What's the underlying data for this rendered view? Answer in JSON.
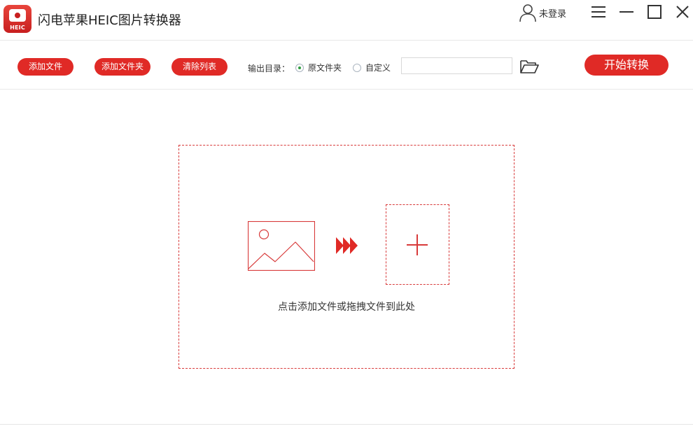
{
  "app": {
    "logo_text": "HEIC",
    "title": "闪电苹果HEIC图片转换器"
  },
  "user": {
    "login_label": "未登录"
  },
  "toolbar": {
    "add_file_label": "添加文件",
    "add_folder_label": "添加文件夹",
    "clear_list_label": "清除列表",
    "output_dir_label": "输出目录：",
    "option_original_label": "原文件夹",
    "option_custom_label": "自定义",
    "selected_option": "原文件夹",
    "path_value": "",
    "path_placeholder": "",
    "start_label": "开始转换"
  },
  "drop_zone": {
    "hint": "点击添加文件或拖拽文件到此处"
  },
  "icons": {
    "logo": "camera-bolt-icon",
    "user": "user-icon",
    "menu": "menu-icon",
    "minimize": "minimize-icon",
    "maximize": "maximize-icon",
    "close": "close-icon",
    "folder": "folder-open-icon",
    "image": "image-icon",
    "arrows": "triple-arrow-icon",
    "plus": "plus-icon"
  },
  "colors": {
    "accent": "#e02a26",
    "dashed_border": "#d83a3a",
    "radio_selected": "#2e9e3f"
  }
}
